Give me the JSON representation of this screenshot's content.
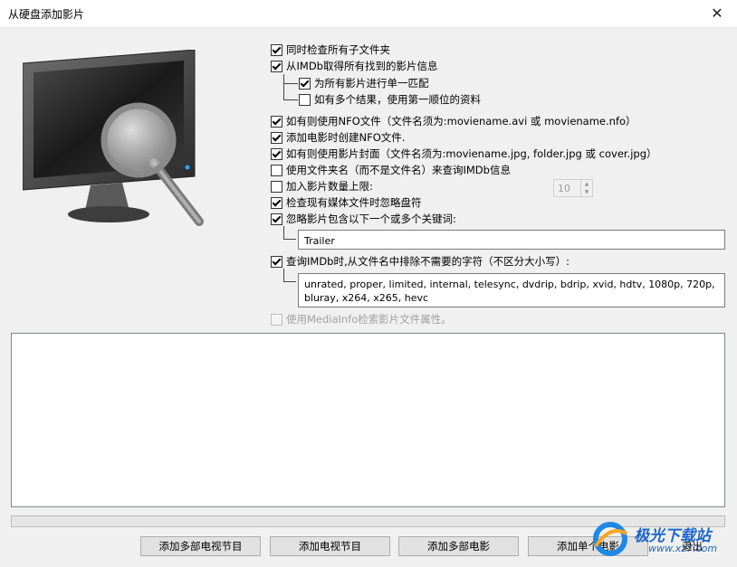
{
  "window": {
    "title": "从硬盘添加影片"
  },
  "options": {
    "scan_subfolders": {
      "label": "同时检查所有子文件夹",
      "checked": true
    },
    "fetch_imdb": {
      "label": "从IMDb取得所有找到的影片信息",
      "checked": true
    },
    "single_match": {
      "label": "为所有影片进行单一匹配",
      "checked": true
    },
    "first_result": {
      "label": "如有多个结果，使用第一顺位的资料",
      "checked": false
    },
    "use_nfo": {
      "label": "如有则使用NFO文件（文件名须为:moviename.avi 或 moviename.nfo）",
      "checked": true
    },
    "create_nfo": {
      "label": "添加电影时创建NFO文件.",
      "checked": true
    },
    "use_cover": {
      "label": "如有则使用影片封面（文件名须为:moviename.jpg, folder.jpg 或 cover.jpg）",
      "checked": true
    },
    "folder_name": {
      "label": "使用文件夹名（而不是文件名）来查询IMDb信息",
      "checked": false
    },
    "limit": {
      "label": "加入影片数量上限:",
      "checked": false,
      "value": "10"
    },
    "ignore_drive": {
      "label": "检查现有媒体文件时忽略盘符",
      "checked": true
    },
    "ignore_keywords": {
      "label": "忽略影片包含以下一个或多个关键词:",
      "checked": true,
      "value": "Trailer"
    },
    "strip_chars": {
      "label": "查询IMDb时,从文件名中排除不需要的字符（不区分大小写）:",
      "checked": true,
      "value": "unrated, proper, limited, internal, telesync, dvdrip, bdrip, xvid, hdtv, 1080p, 720p, bluray, x264, x265, hevc"
    },
    "mediainfo": {
      "label": "使用MediaInfo检索影片文件属性。",
      "checked": false
    }
  },
  "progress": {
    "value": 0
  },
  "buttons": {
    "add_tv_series": "添加多部电视节目",
    "add_tv": "添加电视节目",
    "add_movies": "添加多部电影",
    "add_movie": "添加单个电影",
    "exit": "退出"
  },
  "watermark": {
    "name": "极光下载站",
    "url": "www.xz7.com"
  }
}
